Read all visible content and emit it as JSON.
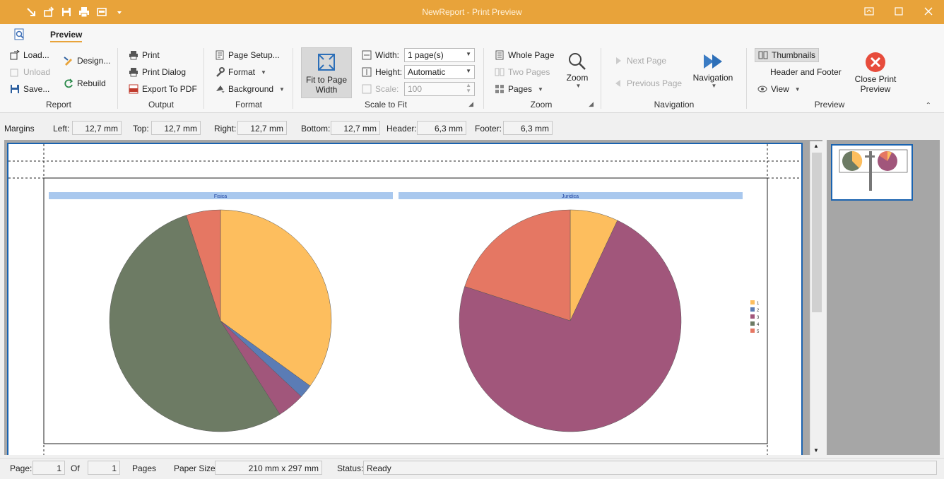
{
  "window": {
    "title": "NewReport - Print Preview"
  },
  "ribbon": {
    "active_tab": "Preview",
    "report": {
      "label": "Report",
      "load": "Load...",
      "unload": "Unload",
      "save": "Save...",
      "design": "Design...",
      "rebuild": "Rebuild"
    },
    "output": {
      "label": "Output",
      "print": "Print",
      "print_dialog": "Print Dialog",
      "export_pdf": "Export To PDF"
    },
    "format": {
      "label": "Format",
      "page_setup": "Page Setup...",
      "format": "Format",
      "background": "Background"
    },
    "scale": {
      "label": "Scale to Fit",
      "fit_line1": "Fit to Page",
      "fit_line2": "Width",
      "width_label": "Width:",
      "width_value": "1 page(s)",
      "height_label": "Height:",
      "height_value": "Automatic",
      "scale_label": "Scale:",
      "scale_value": "100"
    },
    "zoom": {
      "label": "Zoom",
      "whole_page": "Whole Page",
      "two_pages": "Two Pages",
      "pages": "Pages",
      "zoom": "Zoom"
    },
    "navigation": {
      "label": "Navigation",
      "next_page": "Next Page",
      "previous_page": "Previous Page",
      "navigation": "Navigation"
    },
    "preview": {
      "label": "Preview",
      "thumbnails": "Thumbnails",
      "header_footer": "Header and Footer",
      "view": "View",
      "close_line1": "Close Print",
      "close_line2": "Preview"
    }
  },
  "margins": {
    "label": "Margins",
    "left_label": "Left:",
    "left": "12,7 mm",
    "top_label": "Top:",
    "top": "12,7 mm",
    "right_label": "Right:",
    "right": "12,7 mm",
    "bottom_label": "Bottom:",
    "bottom": "12,7 mm",
    "header_label": "Header:",
    "header": "6,3 mm",
    "footer_label": "Footer:",
    "footer": "6,3 mm"
  },
  "chart_data": [
    {
      "type": "pie",
      "title": "Fisica",
      "categories": [
        "1",
        "2",
        "3",
        "4",
        "5"
      ],
      "values": [
        35,
        2,
        4,
        54,
        5
      ],
      "colors": [
        "#fdbe5e",
        "#5b7cb5",
        "#a1567b",
        "#6d7b64",
        "#e57763"
      ]
    },
    {
      "type": "pie",
      "title": "Juridica",
      "categories": [
        "1",
        "2",
        "3",
        "4",
        "5"
      ],
      "values": [
        7,
        0,
        73,
        0,
        20
      ],
      "colors": [
        "#fdbe5e",
        "#5b7cb5",
        "#a1567b",
        "#6d7b64",
        "#e57763"
      ]
    }
  ],
  "legend": {
    "entries": [
      "1",
      "2",
      "3",
      "4",
      "5"
    ]
  },
  "status": {
    "page_label": "Page:",
    "page": "1",
    "of_label": "Of",
    "total": "1",
    "pages_label": "Pages",
    "paper_label": "Paper Size:",
    "paper": "210 mm x 297 mm",
    "status_label": "Status:",
    "status": "Ready"
  },
  "colors": {
    "accent": "#e8a33a",
    "page_border": "#1a63b0",
    "chart_title_band": "#a9c8ee"
  }
}
